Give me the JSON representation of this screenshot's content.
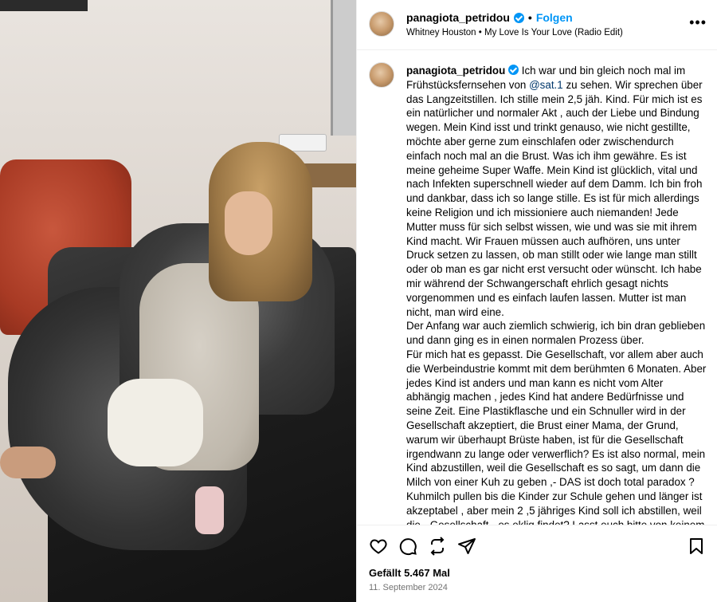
{
  "post": {
    "username": "panagiota_petridou",
    "follow_label": "Folgen",
    "separator": "•",
    "music": "Whitney Houston • My Love Is Your Love (Radio Edit)",
    "more_label": "•••"
  },
  "caption": {
    "username": "panagiota_petridou",
    "intro": "Ich war und bin gleich noch mal im Frühstücksfernsehen von",
    "mention": "@sat.1",
    "p1": "zu sehen. Wir sprechen über das Langzeitstillen. Ich stille mein 2,5 jäh. Kind. Für mich ist es ein natürlicher und normaler Akt , auch der Liebe und Bindung wegen. Mein Kind isst und trinkt genauso, wie nicht gestillte, möchte aber gerne zum einschlafen oder zwischendurch einfach noch mal an die Brust. Was ich ihm gewähre. Es ist meine geheime Super Waffe. Mein Kind ist glücklich, vital und nach Infekten superschnell wieder auf dem Damm. Ich bin froh und dankbar, dass ich so lange stille. Es ist für mich allerdings keine Religion und ich missioniere auch niemanden! Jede Mutter muss für sich selbst wissen, wie und was sie mit ihrem Kind macht. Wir Frauen müssen auch aufhören, uns unter Druck setzen zu lassen, ob man stillt oder wie lange man stillt oder ob man es gar nicht erst versucht oder wünscht. Ich habe mir während der Schwangerschaft ehrlich gesagt nichts vorgenommen und es einfach laufen lassen. Mutter ist man nicht, man wird eine.",
    "p2": "Der Anfang war auch ziemlich schwierig, ich bin dran geblieben und dann ging es in einen normalen Prozess über.",
    "p3": "Für mich hat es gepasst. Die Gesellschaft, vor allem aber auch die Werbeindustrie kommt mit dem berühmten 6 Monaten. Aber jedes Kind ist anders und man kann es nicht vom Alter abhängig machen , jedes Kind hat andere Bedürfnisse und seine Zeit. Eine Plastikflasche und ein Schnuller wird in der Gesellschaft akzeptiert, die Brust einer Mama, der Grund, warum wir überhaupt Brüste haben, ist für die Gesellschaft irgendwann zu lange oder verwerflich? Es ist also normal, mein Kind abzustillen, weil die Gesellschaft es so sagt, um dann die Milch von einer Kuh zu geben ,- DAS ist doch total paradox ? Kuhmilch pullen bis die Kinder zur Schule gehen und länger ist akzeptabel , aber mein 2 ,5 jähriges Kind soll ich abstillen, weil die „ Gesellschaft „ es eklig findet? Lasst euch bitte von keinem, ( meistens sind es die, die selber nicht gestillt haben/ konnten oder Männer), bitte nicht in eure Stillbeziehung reden! Es ist eure Entscheidung!! Ob und wie und wo wann, geht nur euch etwas an."
  },
  "footer": {
    "likes": "Gefällt 5.467 Mal",
    "date": "11. September 2024"
  },
  "icons": [
    "heart-icon",
    "comment-icon",
    "share-icon",
    "send-icon",
    "bookmark-icon"
  ],
  "colors": {
    "link": "#0095f6",
    "mention": "#00376b",
    "muted": "#737373"
  }
}
